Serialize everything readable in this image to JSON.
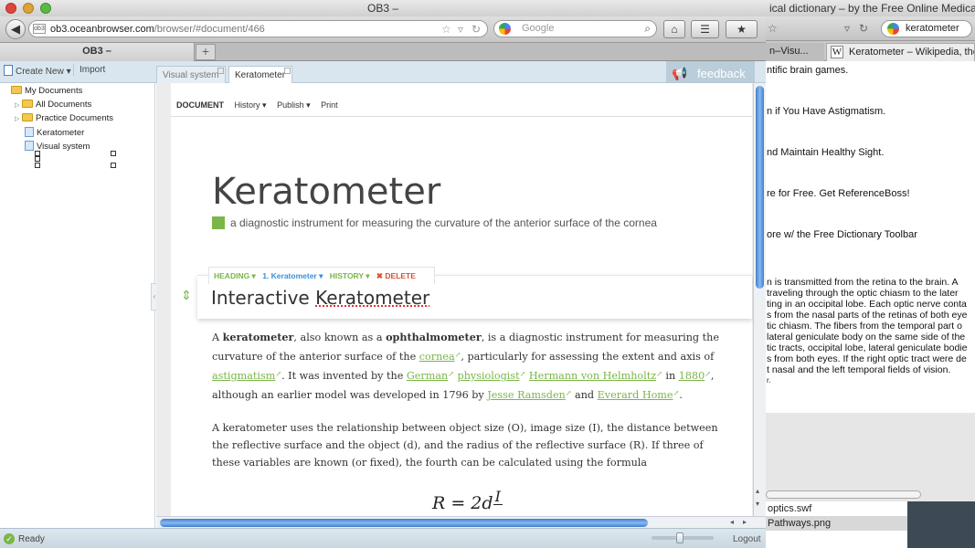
{
  "window": {
    "title": "OB3 –"
  },
  "navbar": {
    "back_icon": "◀",
    "site_badge": "ob3",
    "url_host": "ob3.oceanbrowser.com",
    "url_path": "/browser/#document/466",
    "bookmark_icon": "☆",
    "dropdown_icon": "▿",
    "reload_icon": "↻",
    "search_placeholder": "Google",
    "search_icon": "⌕",
    "home_icon": "⌂",
    "bookmarks_icon": "☰",
    "addon_icon": "★"
  },
  "tabs": {
    "main_tab": "OB3 –",
    "new_tab": "+"
  },
  "apptoolbar": {
    "create_new": "Create New ▾",
    "import": "Import",
    "doc_tabs": [
      "Visual system",
      "Keratometer"
    ],
    "feedback": "feedback",
    "feedback_icon": "📢"
  },
  "sidebar": {
    "items": [
      {
        "label": "My Documents"
      },
      {
        "label": "All Documents"
      },
      {
        "label": "Practice Documents"
      },
      {
        "label": "Keratometer"
      },
      {
        "label": "Visual system"
      }
    ],
    "collapse_icon": "‹"
  },
  "document": {
    "menu": {
      "document": "DOCUMENT",
      "history": "History ▾",
      "publish": "Publish ▾",
      "print": "Print"
    },
    "title": "Keratometer",
    "subtitle": "a diagnostic instrument for measuring the curvature of the anterior surface of the cornea",
    "section_bar": {
      "heading": "HEADING ▾",
      "number": "1. Keratometer ▾",
      "history": "HISTORY ▾",
      "delete": "✖ DELETE"
    },
    "section_heading_plain": "Interactive ",
    "section_heading_word": "Keratometer",
    "drag_icon": "⇕",
    "para1": {
      "t1": "A ",
      "b1": "keratometer",
      "t2": ", also known as a ",
      "b2": "ophthalmometer",
      "t3": ", is a diagnostic instrument for measuring the curvature of the anterior surface of the ",
      "l1": "cornea",
      "t4": ", particularly for assessing the extent and axis of ",
      "l2": "astigmatism",
      "t5": ". It was invented by the ",
      "l3": "German",
      "l4": "physiologist",
      "l5": "Hermann von Helmholtz",
      "t6": " in ",
      "l6": "1880",
      "t7": ", although an earlier model was developed in 1796 by ",
      "l7": "Jesse Ramsden",
      "t8": " and ",
      "l8": "Everard Home",
      "t9": ".",
      "ext_icon": "↗"
    },
    "para2": "A keratometer uses the relationship between object size (O), image size (I), the distance between the reflective surface and the object (d), and the radius of the reflective surface (R). If three of these variables are known (or fixed), the fourth can be calculated using the formula",
    "formula": {
      "lhs": "R = 2d",
      "numerator": "I"
    }
  },
  "scroll": {
    "up": "▴",
    "down": "▾",
    "left": "◂",
    "right": "▸"
  },
  "statusbar": {
    "ready_icon": "✓",
    "ready": "Ready",
    "logout": "Logout",
    "zoom_level": 0.45
  },
  "background_window": {
    "title": "ical dictionary – by the Free Online Medical",
    "search_value": "keratometer",
    "tab1": "n–Visu...",
    "tab2": "Keratometer – Wikipedia, the",
    "tab2_icon": "W",
    "lines": [
      "ntific brain games.",
      "n if You Have Astigmatism.",
      "nd Maintain Healthy Sight.",
      "re for Free. Get ReferenceBoss!",
      "ore w/ the Free Dictionary Toolbar"
    ],
    "paragraph": [
      "n is transmitted from the retina to the brain. A",
      "traveling through the optic chiasm to the later",
      "ting in an occipital lobe. Each optic nerve conta",
      "s from the nasal parts of the retinas of both eye",
      "tic chiasm. The fibers from the temporal part o",
      "lateral geniculate body on the same side of the",
      "tic tracts, occipital lobe, lateral geniculate bodie",
      "s from both eyes. If the right optic tract were de",
      "t nasal and the left temporal fields of vision.",
      "r."
    ],
    "files": [
      "optics.swf",
      "Pathways.png"
    ]
  }
}
